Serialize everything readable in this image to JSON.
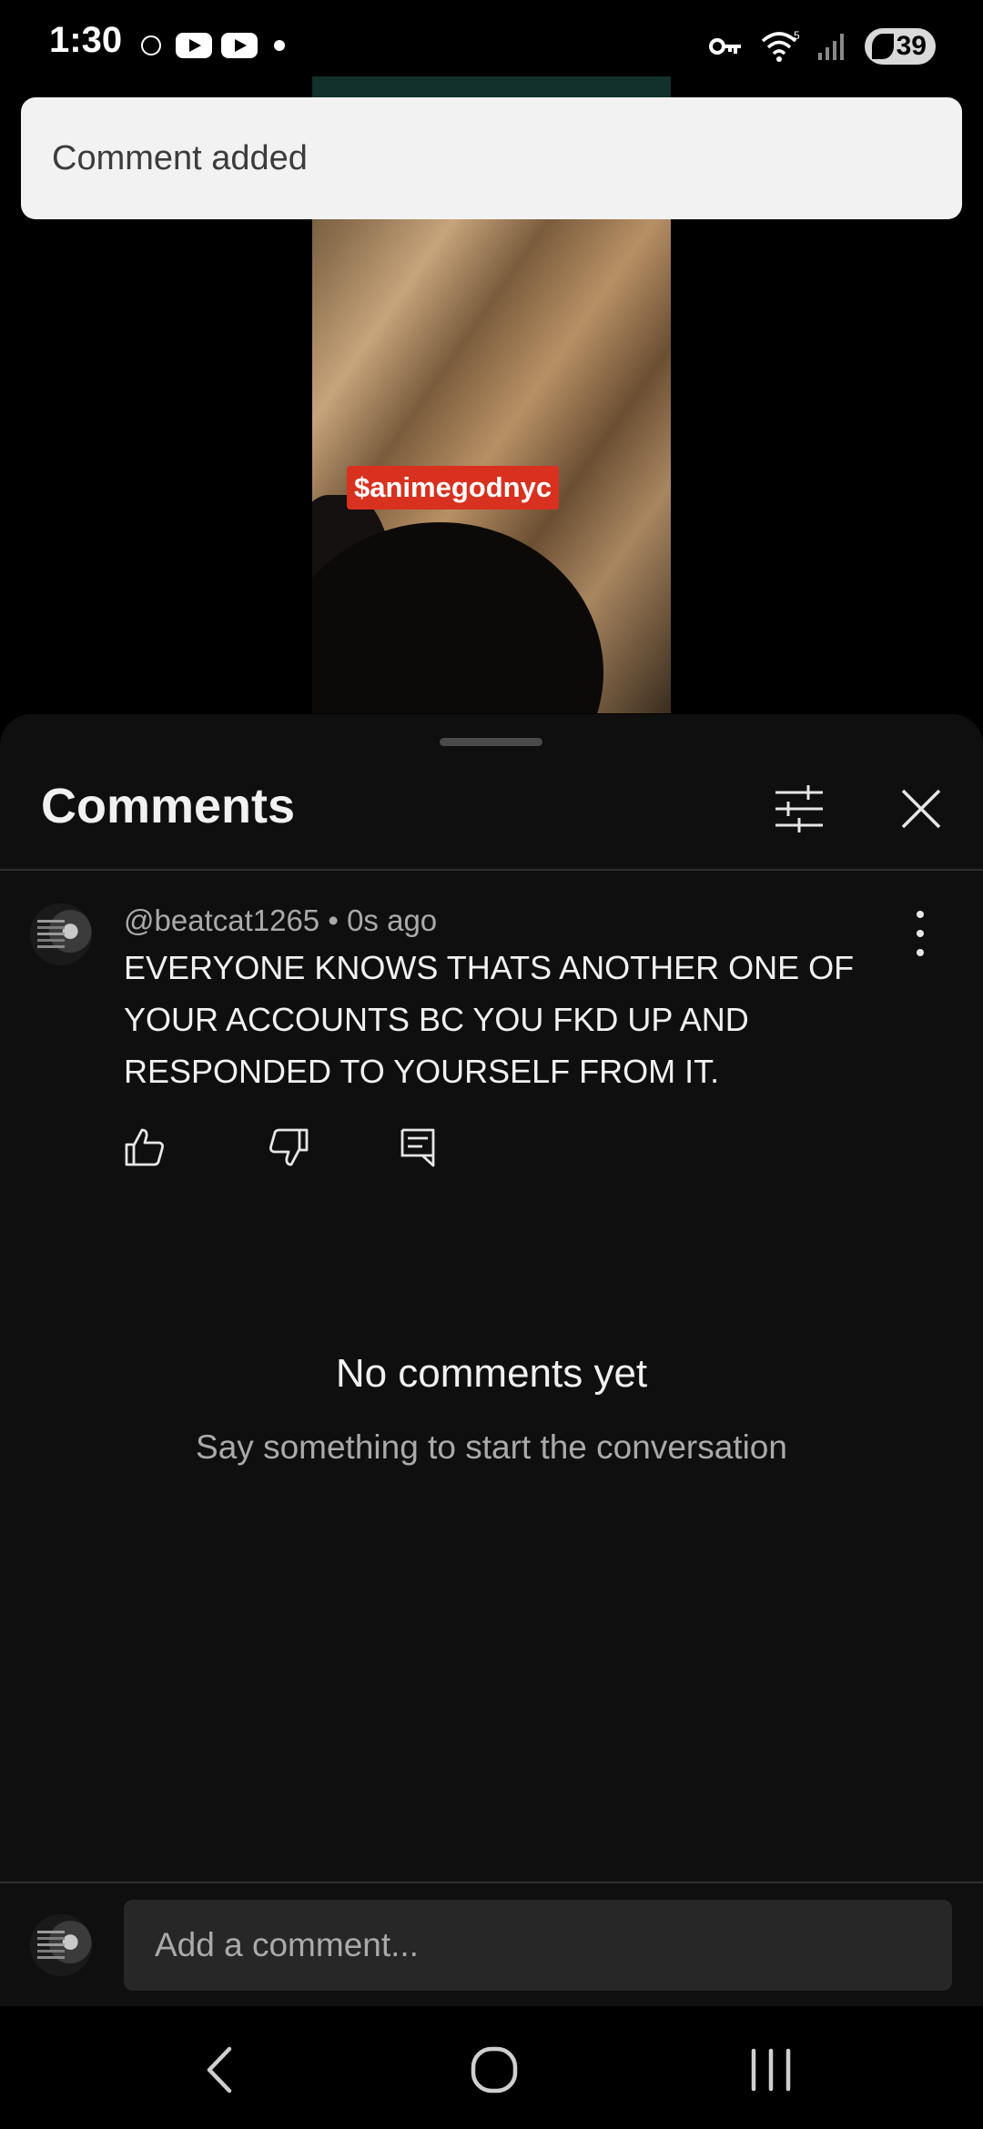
{
  "status_bar": {
    "time": "1:30",
    "battery": "39"
  },
  "video": {
    "tag": "$animegodnyc"
  },
  "toast": {
    "message": "Comment added"
  },
  "comments_panel": {
    "title": "Comments",
    "comment": {
      "author": "@beatcat1265",
      "separator": "•",
      "time": "0s ago",
      "text": "EVERYONE KNOWS THATS ANOTHER ONE OF YOUR ACCOUNTS BC YOU FKD UP AND RESPONDED TO YOURSELF FROM IT."
    },
    "empty_title": "No comments yet",
    "empty_subtitle": "Say something to start the conversation"
  },
  "input": {
    "placeholder": "Add a comment..."
  },
  "colors": {
    "sheet_bg": "#0f0f0f",
    "toast_bg": "#f2f2f2",
    "tag_bg": "#d8311f",
    "input_bg": "#272727"
  },
  "icons": [
    "key-icon",
    "wifi-icon",
    "signal-icon",
    "filter-icon",
    "close-icon",
    "more-icon",
    "like-icon",
    "dislike-icon",
    "reply-icon",
    "back-icon",
    "home-icon",
    "recents-icon"
  ]
}
